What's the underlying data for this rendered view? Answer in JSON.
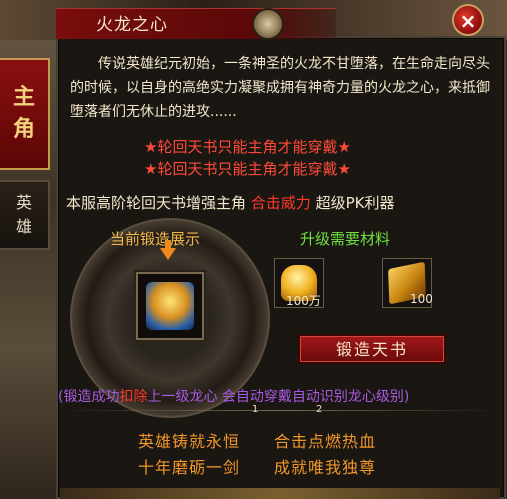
{
  "window": {
    "title": "火龙之心",
    "close_label": "×"
  },
  "tabs": [
    {
      "chars": [
        "主",
        "角"
      ]
    },
    {
      "chars": [
        "英",
        "雄"
      ]
    }
  ],
  "intro_text": "传说英雄纪元初始，一条神圣的火龙不甘堕落，在生命走向尽头的时候，以自身的高绝实力凝聚成拥有神奇力量的火龙之心，来抵御堕落者们无休止的进攻......",
  "warnings": [
    "★轮回天书只能主角才能穿戴★",
    "★轮回天书只能主角才能穿戴★"
  ],
  "enhance_line": {
    "prefix": "本服高阶轮回天书增强主角",
    "highlight": "合击威力",
    "suffix": "超级PK利器"
  },
  "forge_display_label": "当前锻造展示",
  "materials_label": "升级需要材料",
  "materials": [
    {
      "name": "gold-ingot-icon",
      "count": "100万"
    },
    {
      "name": "gold-scroll-icon",
      "count": "100"
    }
  ],
  "forge_button": "锻造天书",
  "notice": {
    "prefix": "(锻造成功",
    "highlight": "扣除",
    "suffix": "上一级龙心 会自动穿戴自动识别龙心级别)"
  },
  "page_markers": [
    "1",
    "2"
  ],
  "poem": [
    "英雄铸就永恒",
    "合击点燃热血",
    "十年磨砺一剑",
    "成就唯我独尊"
  ],
  "colors": {
    "accent_red": "#ff3a2a",
    "gold": "#f0b84a",
    "green": "#6ee040",
    "orange": "#f0962a",
    "purple": "#a85ae0"
  }
}
